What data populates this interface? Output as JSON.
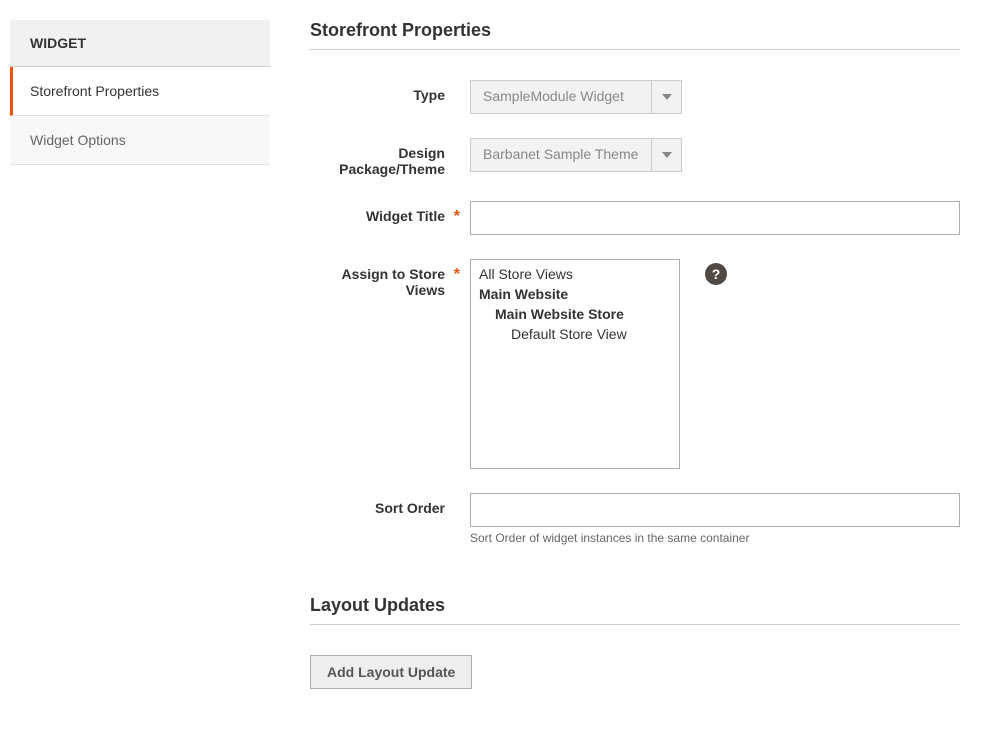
{
  "sidebar": {
    "header": "WIDGET",
    "tabs": [
      {
        "label": "Storefront Properties",
        "active": true
      },
      {
        "label": "Widget Options",
        "active": false
      }
    ]
  },
  "section": {
    "title": "Storefront Properties"
  },
  "fields": {
    "type": {
      "label": "Type",
      "value": "SampleModule Widget"
    },
    "theme": {
      "label": "Design Package/Theme",
      "value": "Barbanet Sample Theme"
    },
    "title": {
      "label": "Widget Title",
      "value": ""
    },
    "stores": {
      "label": "Assign to Store Views",
      "options": {
        "all": "All Store Views",
        "website": "Main Website",
        "store": "Main Website Store",
        "storeview": "Default Store View"
      }
    },
    "sort": {
      "label": "Sort Order",
      "value": "",
      "note": "Sort Order of widget instances in the same container"
    }
  },
  "layout": {
    "title": "Layout Updates",
    "add_button": "Add Layout Update"
  },
  "help_glyph": "?"
}
